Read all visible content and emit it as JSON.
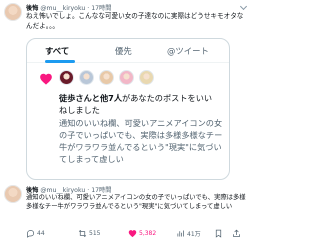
{
  "top_tweet": {
    "name": "後悔",
    "handle": "@mu__kiryoku",
    "time": "17時間",
    "text": "ねえ怖いでしょ。こんなな可愛い女の子達なのに実際はどうせキモオタなんだよ。。。"
  },
  "card": {
    "tabs": [
      {
        "label": "すべて",
        "active": true
      },
      {
        "label": "優先",
        "active": false
      },
      {
        "label": "@ツイート",
        "active": false
      }
    ],
    "notification": {
      "actor": "徒歩さんと他7人",
      "action": "があなたのポストをいいねしました",
      "quoted_text": "通知のいいね欄、可愛いアニメアイコンの女の子でいっぱいでも、実際は多様多様なチー牛がワラワラ並んでるという\"現実\"に気づいてしまって虚しい"
    },
    "avatar_colors": [
      "#6a1b2a",
      "#b9c7d8",
      "#e8c9a8",
      "#f2b7c7",
      "#e9d8b0"
    ]
  },
  "reply_tweet": {
    "name": "後悔",
    "handle": "@mu__kiryoku",
    "time": "17時間",
    "text": "通知のいいね欄、可愛いアニメアイコンの女の子でいっぱいでも、実際は多様多様なチー牛がワラワラ並んでるという\"現実\"に気づいてしまって虚しい"
  },
  "actions": {
    "reply_count": "44",
    "retweet_count": "515",
    "like_count": "5,382",
    "views_count": "41万"
  },
  "colors": {
    "accent": "#1d9bf0",
    "like": "#f91880",
    "muted": "#536471"
  }
}
